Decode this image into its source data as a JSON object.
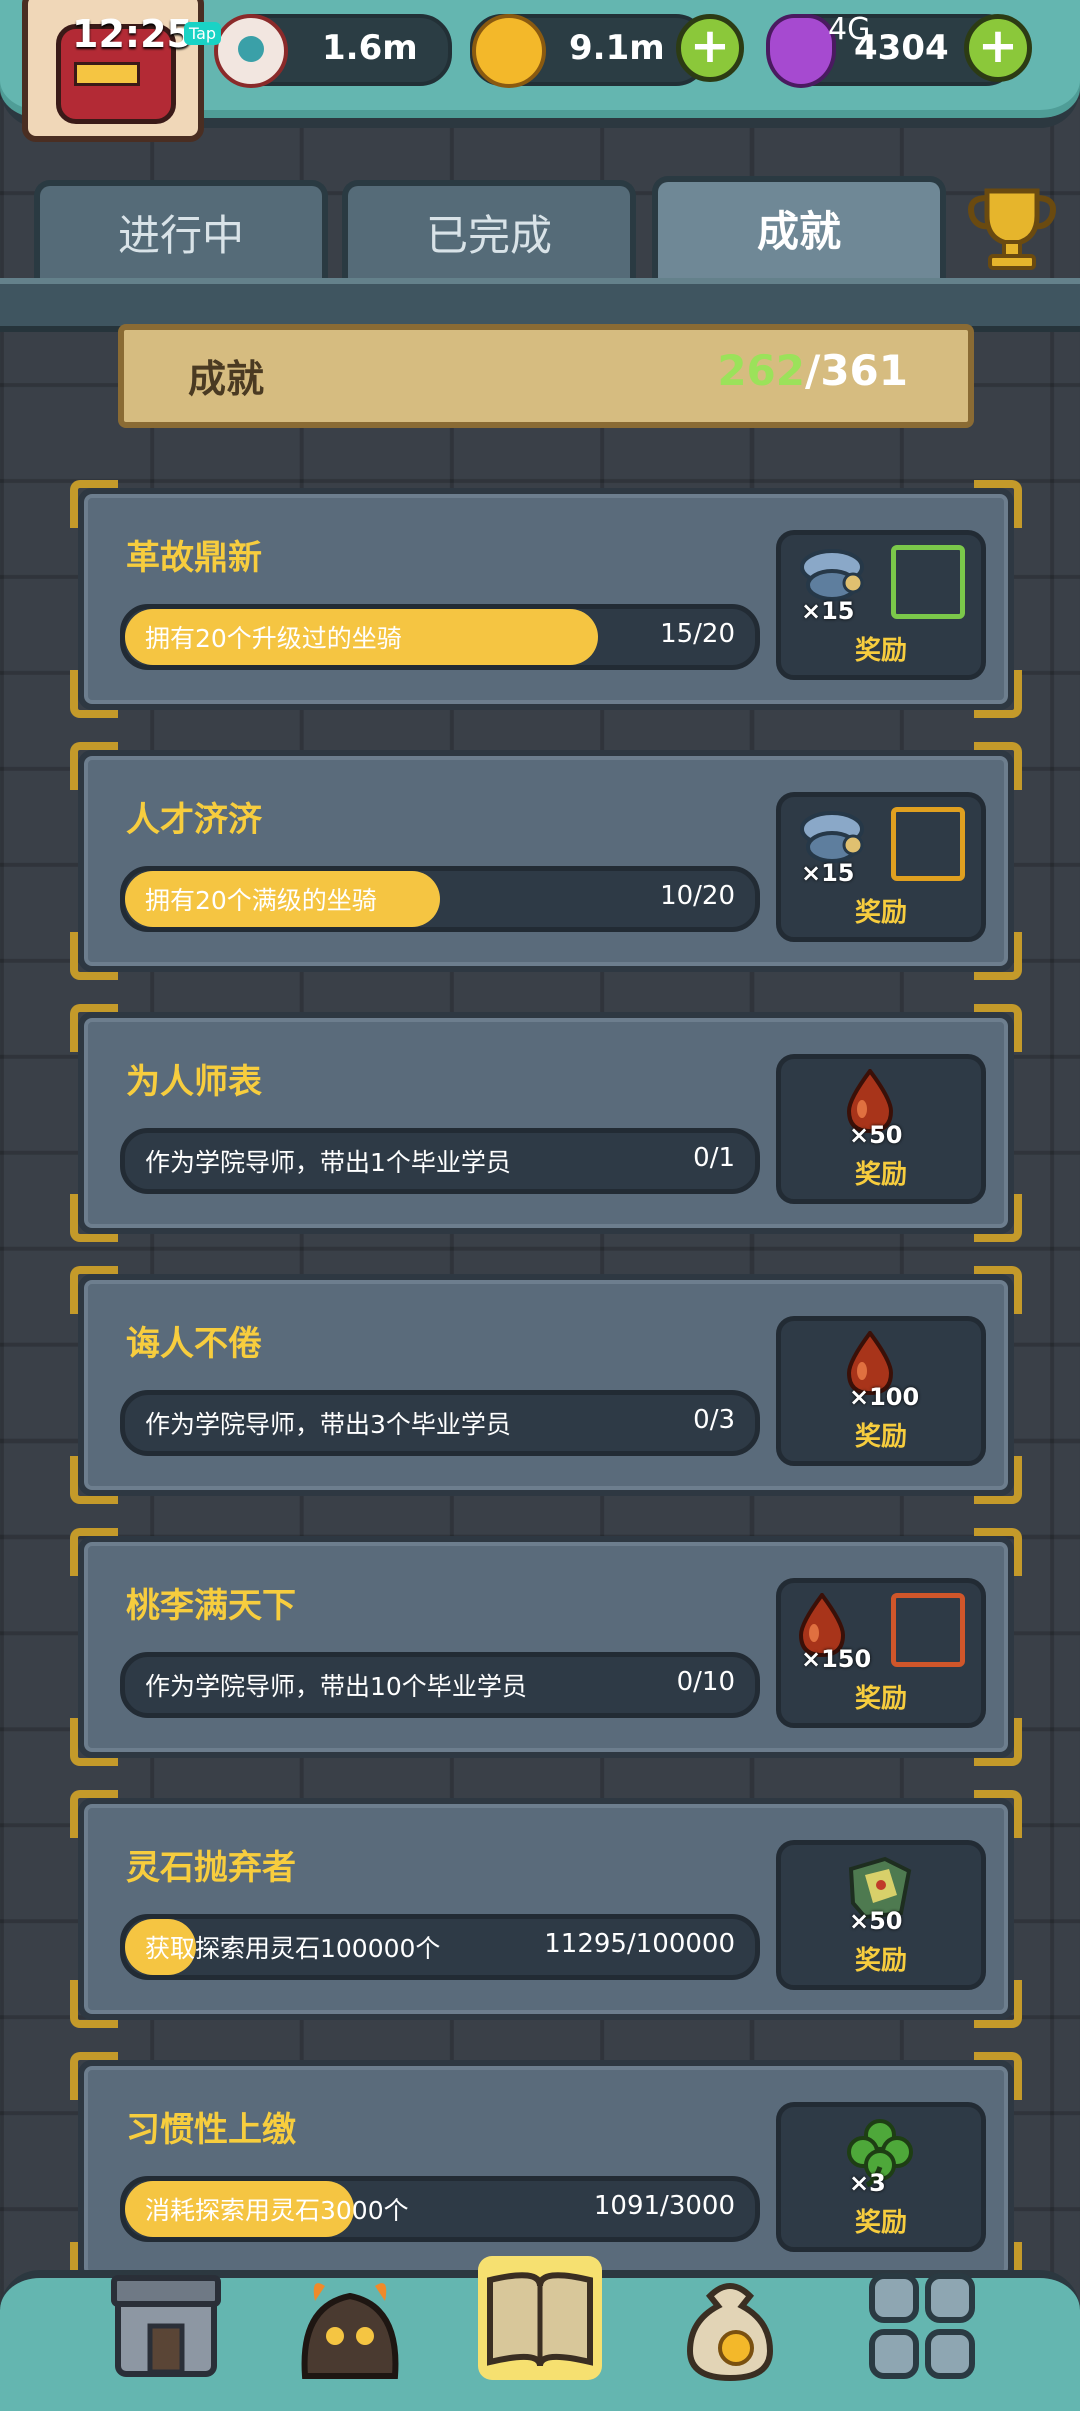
{
  "status_bar": {
    "time": "12:25",
    "tap_label": "Tap",
    "right_text": "4G"
  },
  "resources": [
    {
      "name": "eyeball",
      "value": "1.6m"
    },
    {
      "name": "coin",
      "value": "9.1m"
    },
    {
      "name": "potion",
      "value": "4304"
    }
  ],
  "tabs": [
    {
      "label": "进行中",
      "active": false
    },
    {
      "label": "已完成",
      "active": false
    },
    {
      "label": "成就",
      "active": true
    }
  ],
  "summary": {
    "label": "成就",
    "done": "262",
    "sep": "/",
    "total": "361"
  },
  "reward_label": "奖励",
  "achievements": [
    {
      "title": "革故鼎新",
      "desc": "拥有20个升级过的坐骑",
      "progress": "15/20",
      "fraction": 0.75,
      "reward_qty": "×15",
      "reward_icon": "mount-icon",
      "frame_color": "#7bc84a"
    },
    {
      "title": "人才济济",
      "desc": "拥有20个满级的坐骑",
      "progress": "10/20",
      "fraction": 0.5,
      "reward_qty": "×15",
      "reward_icon": "mount-icon",
      "frame_color": "#e0a020"
    },
    {
      "title": "为人师表",
      "desc": "作为学院导师，带出1个毕业学员",
      "progress": "0/1",
      "fraction": 0,
      "reward_qty": "×50",
      "reward_icon": "blood-drop-icon",
      "frame_color": ""
    },
    {
      "title": "诲人不倦",
      "desc": "作为学院导师，带出3个毕业学员",
      "progress": "0/3",
      "fraction": 0,
      "reward_qty": "×100",
      "reward_icon": "blood-drop-icon",
      "frame_color": ""
    },
    {
      "title": "桃李满天下",
      "desc": "作为学院导师，带出10个毕业学员",
      "progress": "0/10",
      "fraction": 0,
      "reward_qty": "×150",
      "reward_icon": "blood-drop-icon",
      "frame_color": "#d0562a"
    },
    {
      "title": "灵石抛弃者",
      "desc": "获取探索用灵石100000个",
      "progress": "11295/100000",
      "fraction": 0.113,
      "reward_qty": "×50",
      "reward_icon": "map-icon",
      "frame_color": ""
    },
    {
      "title": "习惯性上缴",
      "desc": "消耗探索用灵石3000个",
      "progress": "1091/3000",
      "fraction": 0.364,
      "reward_qty": "×3",
      "reward_icon": "clover-icon",
      "frame_color": ""
    }
  ],
  "nav": [
    "shop-icon",
    "monster-icon",
    "book-icon",
    "money-bag-icon",
    "grid-menu-icon"
  ]
}
